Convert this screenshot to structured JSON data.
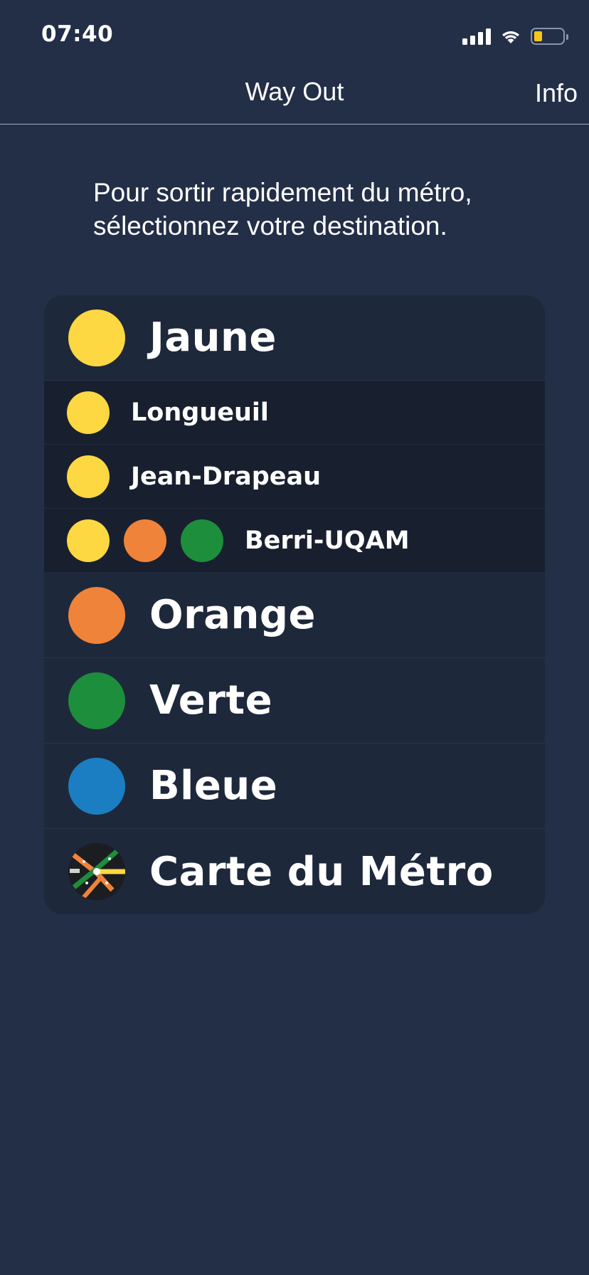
{
  "status_bar": {
    "time": "07:40"
  },
  "nav": {
    "title": "Way Out",
    "info_label": "Info"
  },
  "intro_text": "Pour sortir rapidement du métro, sélectionnez votre destination.",
  "lines": {
    "jaune": {
      "label": "Jaune",
      "color": "#fdd842",
      "stations": [
        {
          "label": "Longueuil"
        },
        {
          "label": "Jean-Drapeau"
        },
        {
          "label": "Berri-UQAM"
        }
      ]
    },
    "orange": {
      "label": "Orange",
      "color": "#f0833a"
    },
    "verte": {
      "label": "Verte",
      "color": "#1d8e3c"
    },
    "bleue": {
      "label": "Bleue",
      "color": "#1b7ec3"
    },
    "map": {
      "label": "Carte du Métro"
    }
  },
  "icons": {
    "signal": "cellular-signal-icon",
    "wifi": "wifi-icon",
    "battery": "battery-icon",
    "map": "metro-map-icon"
  }
}
